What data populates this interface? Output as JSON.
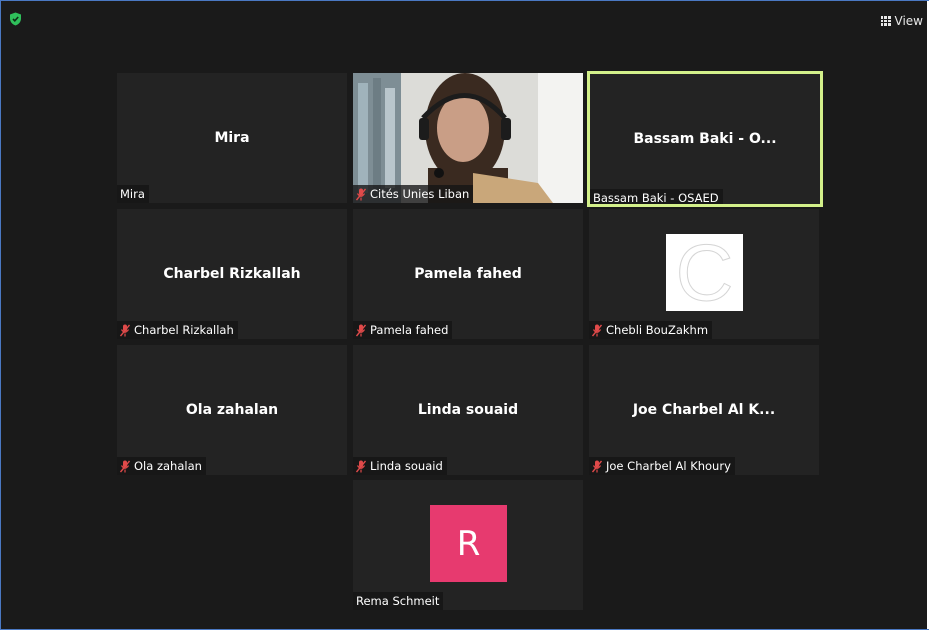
{
  "toolbar": {
    "view_label": "View"
  },
  "participants": [
    {
      "center": "Mira",
      "label": "Mira",
      "muted": false,
      "kind": "name"
    },
    {
      "center": "",
      "label": "Cités Unies Liban",
      "muted": true,
      "kind": "video"
    },
    {
      "center": "Bassam Baki - O...",
      "label": "Bassam Baki - OSAED",
      "muted": false,
      "kind": "name",
      "active": true
    },
    {
      "center": "Charbel Rizkallah",
      "label": "Charbel Rizkallah",
      "muted": true,
      "kind": "name"
    },
    {
      "center": "Pamela fahed",
      "label": "Pamela fahed",
      "muted": true,
      "kind": "name"
    },
    {
      "center": "",
      "label": "Chebli BouZakhm",
      "muted": true,
      "kind": "avatar",
      "avatar_letter": "C"
    },
    {
      "center": "Ola zahalan",
      "label": "Ola zahalan",
      "muted": true,
      "kind": "name"
    },
    {
      "center": "Linda souaid",
      "label": "Linda souaid",
      "muted": true,
      "kind": "name"
    },
    {
      "center": "Joe Charbel Al K...",
      "label": "Joe Charbel Al Khoury",
      "muted": true,
      "kind": "name"
    },
    {
      "center": "",
      "label": "Rema Schmeit",
      "muted": false,
      "kind": "avatar",
      "avatar_letter": "R"
    }
  ],
  "colors": {
    "active_border": "#d3f08a",
    "avatar_r": "#e73a6f",
    "muted_icon": "#e04a4a",
    "shield": "#2fbf5b"
  },
  "icons": [
    "shield-icon",
    "grid-view-icon",
    "muted-mic-icon"
  ]
}
